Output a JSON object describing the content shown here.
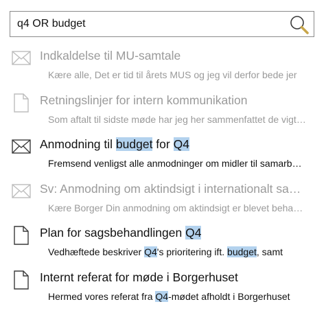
{
  "search": {
    "query": "q4 OR budget",
    "icon": "search-icon"
  },
  "colors": {
    "highlight": "#b3d2ee",
    "dimmed_text": "#9a9a9a",
    "normal_text": "#111111",
    "dimmed_icon": "#bdbdbd",
    "normal_icon": "#3a3a3a"
  },
  "results": [
    {
      "icon": "mail-icon",
      "dimmed": true,
      "title": [
        {
          "t": "Indkaldelse til MU-samtale"
        }
      ],
      "snippet": [
        {
          "t": "Kære alle, Det er tid til årets MUS og jeg vil derfor bede jer"
        }
      ]
    },
    {
      "icon": "document-icon",
      "dimmed": true,
      "title": [
        {
          "t": "Retningslinjer for intern kommunikation"
        }
      ],
      "snippet": [
        {
          "t": "Som aftalt til sidste møde har jeg her sammenfattet de vigtigste"
        }
      ]
    },
    {
      "icon": "mail-icon",
      "dimmed": false,
      "title": [
        {
          "t": "Anmodning til "
        },
        {
          "t": "budget",
          "hl": true
        },
        {
          "t": " for "
        },
        {
          "t": "Q4",
          "hl": true
        }
      ],
      "snippet": [
        {
          "t": "Fremsend venligst alle anmodninger om midler til samarbejde"
        }
      ]
    },
    {
      "icon": "mail-icon",
      "dimmed": true,
      "title": [
        {
          "t": "Sv: Anmodning om aktindsigt i internationalt samarbejde"
        }
      ],
      "snippet": [
        {
          "t": "Kære Borger  Din anmodning om aktindsigt er blevet behandlet"
        }
      ]
    },
    {
      "icon": "document-icon",
      "dimmed": false,
      "title": [
        {
          "t": "Plan for sagsbehandlingen "
        },
        {
          "t": "Q4",
          "hl": true
        }
      ],
      "snippet": [
        {
          "t": "Vedhæftede beskriver "
        },
        {
          "t": "Q4",
          "hl": true
        },
        {
          "t": "'s prioritering ift. "
        },
        {
          "t": "budget",
          "hl": true
        },
        {
          "t": ", samt"
        }
      ]
    },
    {
      "icon": "document-icon",
      "dimmed": false,
      "title": [
        {
          "t": "Internt referat for møde i Borgerhuset"
        }
      ],
      "snippet": [
        {
          "t": "Hermed vores referat fra "
        },
        {
          "t": "Q4",
          "hl": true
        },
        {
          "t": "-mødet afholdt i Borgerhuset"
        }
      ]
    }
  ]
}
